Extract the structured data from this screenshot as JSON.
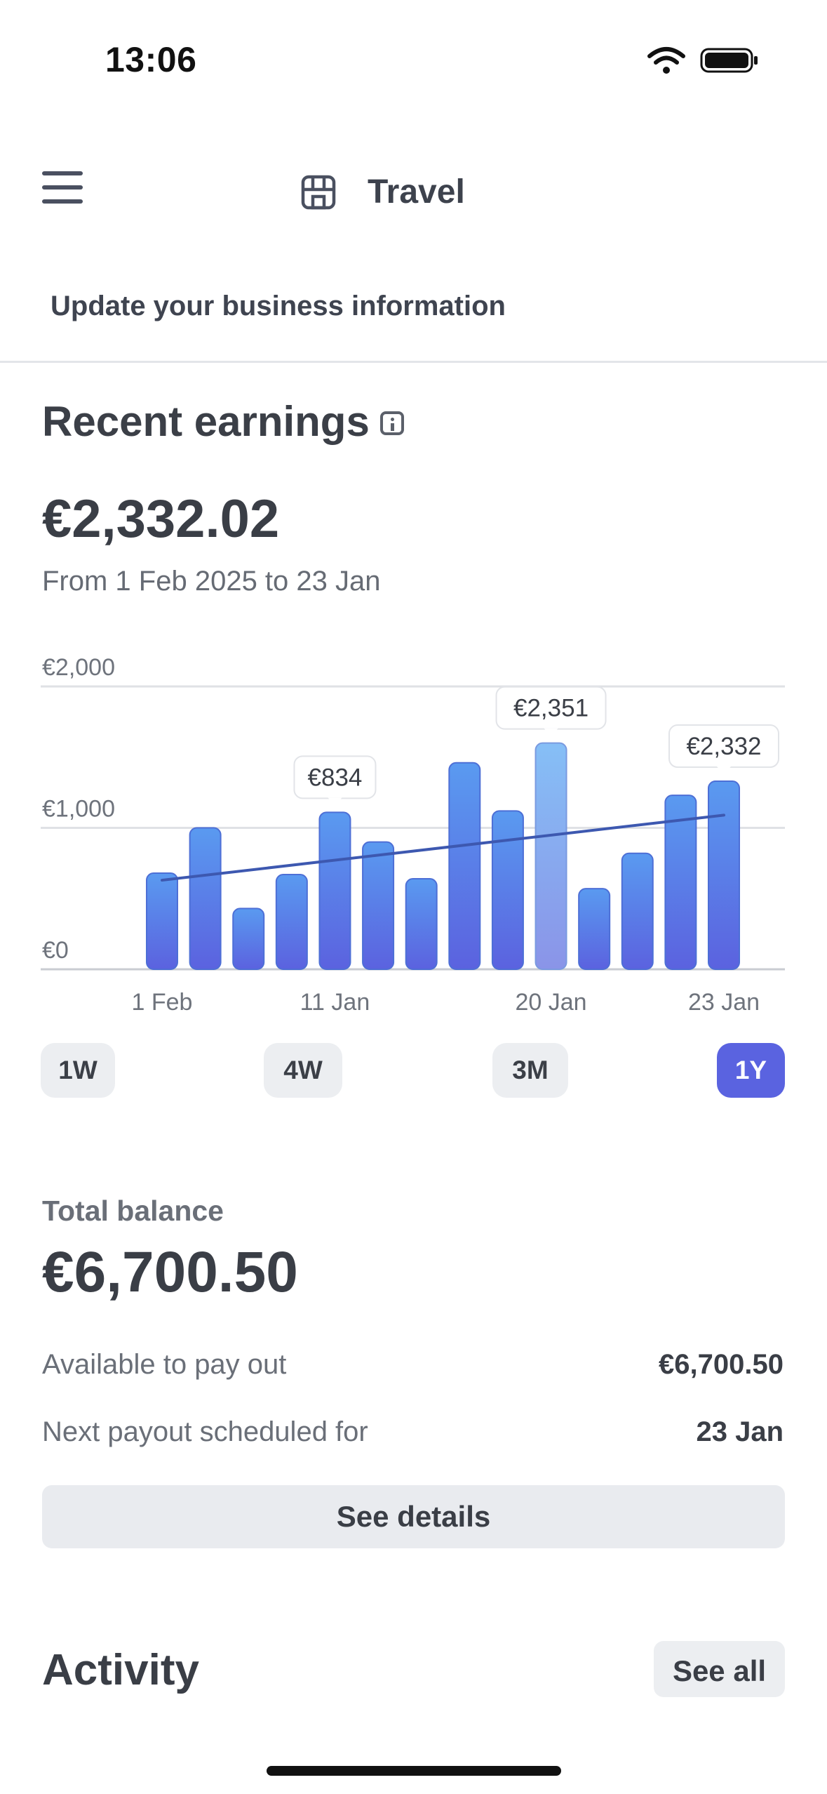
{
  "status_bar": {
    "time": "13:06",
    "icons": [
      "wifi-icon",
      "battery-icon"
    ]
  },
  "header": {
    "title": "Travel",
    "menu_icon": "hamburger-menu-icon",
    "store_icon": "storefront-icon"
  },
  "notice": {
    "text": "Update your business information"
  },
  "earnings": {
    "title": "Recent earnings",
    "amount": "€2,332.02",
    "range": "From 1 Feb 2025 to 23 Jan"
  },
  "chart_data": {
    "type": "bar",
    "ylim": [
      0,
      2000
    ],
    "y_ticks": [
      {
        "value": 2000,
        "label": "€2,000"
      },
      {
        "value": 1000,
        "label": "€1,000"
      },
      {
        "value": 0,
        "label": "€0"
      }
    ],
    "values": [
      680,
      1000,
      430,
      670,
      1110,
      900,
      640,
      1460,
      1120,
      1600,
      570,
      820,
      1230,
      1330
    ],
    "x_tick_labels": [
      {
        "index": 0,
        "label": "1 Feb"
      },
      {
        "index": 4,
        "label": "11 Jan"
      },
      {
        "index": 9,
        "label": "20 Jan"
      },
      {
        "index": 13,
        "label": "23 Jan"
      }
    ],
    "callouts": [
      {
        "index": 4,
        "label": "€834"
      },
      {
        "index": 9,
        "label": "€2,351"
      },
      {
        "index": 13,
        "label": "€2,332"
      }
    ],
    "highlighted_index": 9,
    "trend": {
      "start": 630,
      "end": 1090
    },
    "grid": true,
    "colors": {
      "bar_top": "#5a9af0",
      "bar_bottom": "#5b62df",
      "highlight_top": "#86bff6",
      "highlight_bottom": "#8a94e8",
      "trend": "#3d58b0"
    }
  },
  "periods": [
    {
      "label": "1W",
      "active": false
    },
    {
      "label": "4W",
      "active": false
    },
    {
      "label": "3M",
      "active": false
    },
    {
      "label": "1Y",
      "active": true
    }
  ],
  "balance": {
    "label": "Total balance",
    "amount": "€6,700.50",
    "available_label": "Available to pay out",
    "available_value": "€6,700.50",
    "next_label": "Next payout scheduled for",
    "next_value": "23 Jan",
    "details_button": "See details"
  },
  "activity": {
    "title": "Activity",
    "see_all": "See all"
  },
  "colors": {
    "accent": "#5a63e0"
  }
}
